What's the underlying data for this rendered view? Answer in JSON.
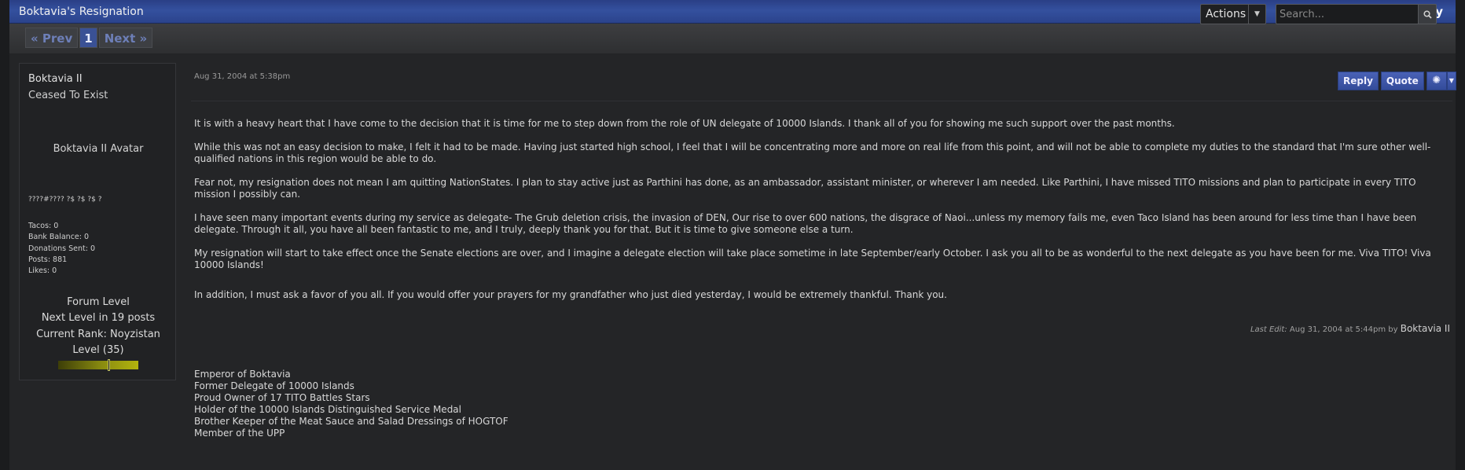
{
  "topic": {
    "title": "Boktavia's Resignation",
    "reply_label": "Reply"
  },
  "pager": {
    "prev_label": "« Prev",
    "current_page": "1",
    "next_label": "Next »"
  },
  "actions": {
    "label": "Actions",
    "caret_icon": "chevron-down-icon"
  },
  "search": {
    "placeholder": "Search...",
    "icon": "search-icon"
  },
  "user": {
    "name": "Boktavia II",
    "status": "Ceased To Exist",
    "avatar_alt": "Boktavia II Avatar",
    "custom_field": "????#???? ?$ ?$ ?$ ?",
    "stats": {
      "tacos": "Tacos: 0",
      "bank": "Bank Balance: 0",
      "donations": "Donations Sent: 0",
      "posts": "Posts: 881",
      "likes": "Likes: 0"
    },
    "level": {
      "heading": "Forum Level",
      "next": "Next Level in 19 posts",
      "rank": "Current Rank: Noyzistan",
      "level": "Level (35)",
      "progress_percent": 63
    }
  },
  "post": {
    "date": "Aug 31, 2004 at 5:38pm",
    "buttons": {
      "reply": "Reply",
      "quote": "Quote",
      "options_icon": "gear-icon",
      "dropdown_icon": "chevron-down-icon"
    },
    "paragraphs": [
      "It is with a heavy heart that I have come to the decision that it is time for me to step down from the role of UN delegate of 10000 Islands. I thank all of you for showing me such support over the past months.",
      "While this was not an easy decision to make, I felt it had to be made. Having just started high school, I feel that I will be concentrating more and more on real life from this point, and will not be able to complete my duties to the standard that I'm sure other well-qualified nations in this region would be able to do.",
      "Fear not, my resignation does not mean I am quitting NationStates. I plan to stay active just as Parthini has done, as an ambassador, assistant minister, or wherever I am needed. Like Parthini, I have missed TITO missions and plan to participate in every TITO mission I possibly can.",
      "I have seen many important events during my service as delegate- The Grub deletion crisis, the invasion of DEN, Our rise to over 600 nations, the disgrace of Naoi...unless my memory fails me, even Taco Island has been around for less time than I have been delegate. Through it all, you have all been fantastic to me, and I truly, deeply thank you for that. But it is time to give someone else a turn.",
      "My resignation will start to take effect once the Senate elections are over, and I imagine a delegate election will take place sometime in late September/early October. I ask you all to be as wonderful to the next delegate as you have been for me. Viva TITO! Viva 10000 Islands!",
      "In addition, I must ask a favor of you all. If you would offer your prayers for my grandfather who just died yesterday, I would be extremely thankful. Thank you."
    ],
    "last_edit": {
      "label": "Last Edit:",
      "date": "Aug 31, 2004 at 5:44pm by",
      "by": "Boktavia II"
    },
    "signature": [
      "Emperor of Boktavia",
      "Former Delegate of 10000 Islands",
      "Proud Owner of 17 TITO Battles Stars",
      "Holder of the 10000 Islands Distinguished Service Medal",
      "Brother Keeper of the Meat Sauce and Salad Dressings of HOGTOF",
      "Member of the UPP"
    ]
  }
}
